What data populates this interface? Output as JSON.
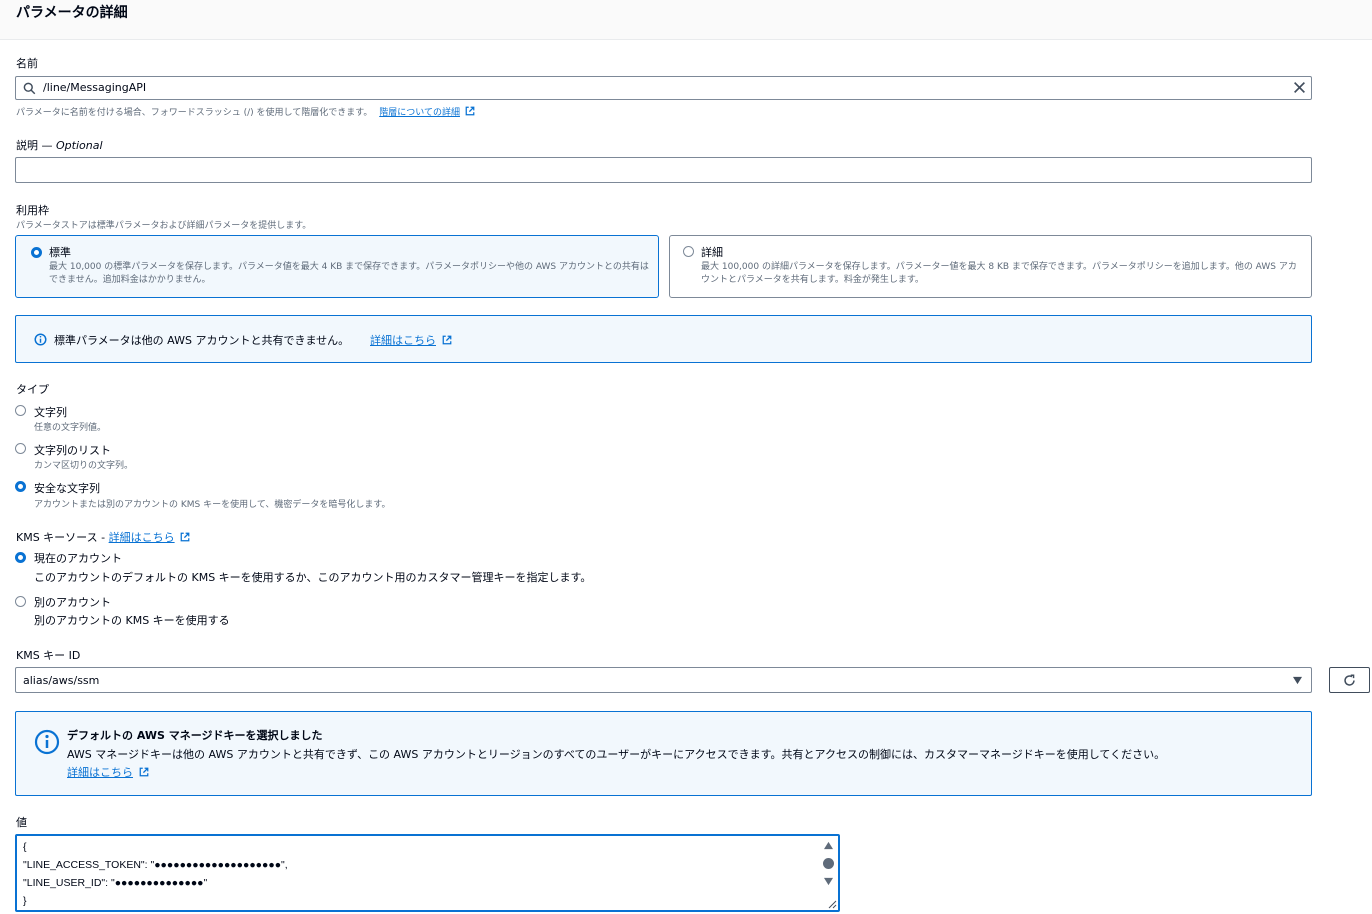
{
  "header": {
    "title": "パラメータの詳細"
  },
  "name": {
    "label": "名前",
    "value": "/line/MessagingAPI",
    "hint": "パラメータに名前を付ける場合、フォワードスラッシュ (/) を使用して階層化できます。",
    "hint_link": "階層についての詳細"
  },
  "description": {
    "label": "説明 — ",
    "optional": "Optional",
    "value": ""
  },
  "tier": {
    "label": "利用枠",
    "hint": "パラメータストアは標準パラメータおよび詳細パラメータを提供します。",
    "options": [
      {
        "title": "標準",
        "desc": "最大 10,000 の標準パラメータを保存します。パラメータ値を最大 4 KB まで保存できます。パラメータポリシーや他の AWS アカウントとの共有はできません。追加料金はかかりません。",
        "selected": true
      },
      {
        "title": "詳細",
        "desc": "最大 100,000 の詳細パラメータを保存します。パラメーター値を最大 8 KB まで保存できます。パラメータポリシーを追加します。他の AWS アカウントとパラメータを共有します。料金が発生します。",
        "selected": false
      }
    ],
    "alert": "標準パラメータは他の AWS アカウントと共有できません。",
    "alert_link": "詳細はこちら"
  },
  "type": {
    "label": "タイプ",
    "options": [
      {
        "title": "文字列",
        "desc": "任意の文字列値。",
        "selected": false
      },
      {
        "title": "文字列のリスト",
        "desc": "カンマ区切りの文字列。",
        "selected": false
      },
      {
        "title": "安全な文字列",
        "desc": "アカウントまたは別のアカウントの KMS キーを使用して、機密データを暗号化します。",
        "selected": true
      }
    ]
  },
  "kms_source": {
    "label": "KMS キーソース - ",
    "link": "詳細はこちら",
    "options": [
      {
        "title": "現在のアカウント",
        "desc": "このアカウントのデフォルトの KMS キーを使用するか、このアカウント用のカスタマー管理キーを指定します。",
        "selected": true
      },
      {
        "title": "別のアカウント",
        "desc": "別のアカウントの KMS キーを使用する",
        "selected": false
      }
    ]
  },
  "kms_key": {
    "label": "KMS キー ID",
    "value": "alias/aws/ssm",
    "alert_title": "デフォルトの AWS マネージドキーを選択しました",
    "alert_body": "AWS マネージドキーは他の AWS アカウントと共有できず、この AWS アカウントとリージョンのすべてのユーザーがキーにアクセスできます。共有とアクセスの制御には、カスタマーマネージドキーを使用してください。",
    "alert_link": "詳細はこちら"
  },
  "value": {
    "label": "値",
    "lines": [
      "{",
      "\"LINE_ACCESS_TOKEN\": \"●●●●●●●●●●●●●●●●●●●●\",",
      "\"LINE_USER_ID\": \"●●●●●●●●●●●●●●\"",
      "}"
    ]
  },
  "colors": {
    "accent": "#0972d3",
    "info_bg": "#f2f8fd",
    "text": "#000716",
    "hint": "#5f6b7a"
  },
  "icons": [
    "search-icon",
    "clear-icon",
    "external-link-icon",
    "info-icon",
    "caret-down-icon",
    "refresh-icon",
    "scroll-up-icon",
    "scroll-down-icon",
    "resize-handle-icon"
  ]
}
